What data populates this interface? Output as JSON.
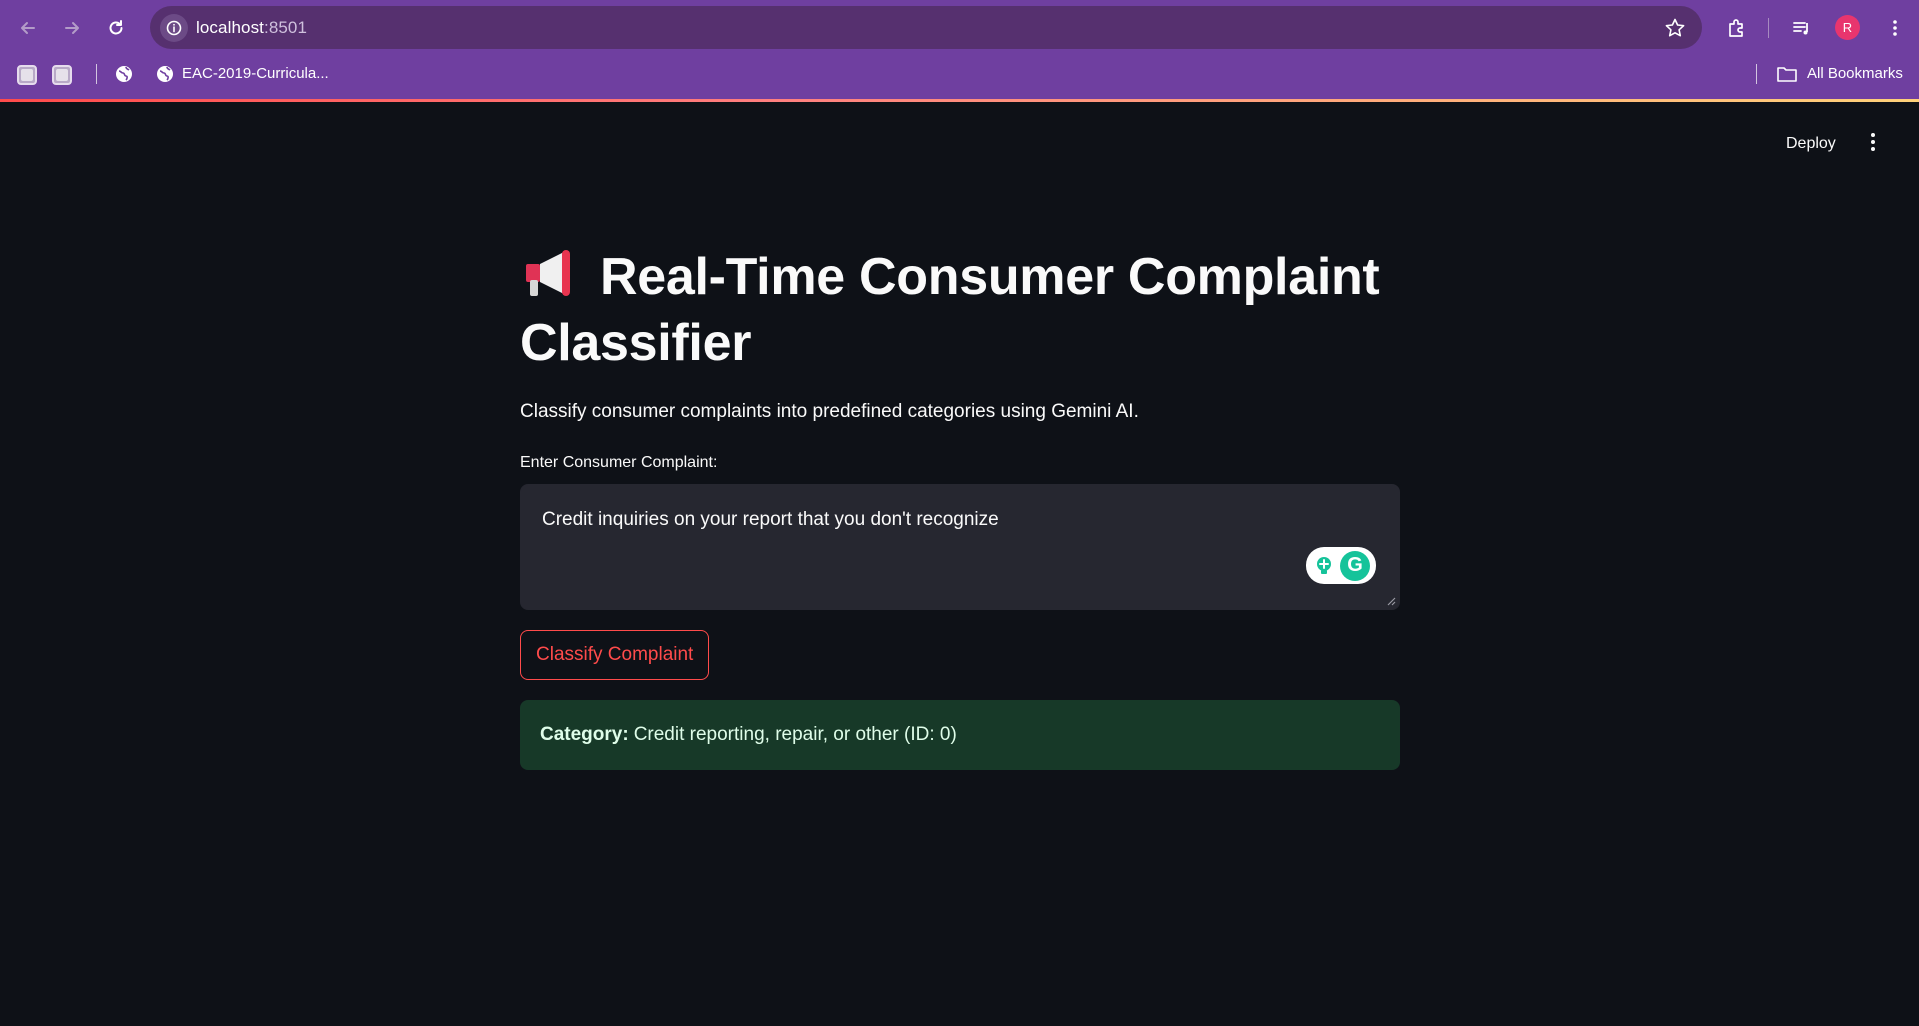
{
  "browser": {
    "url_host": "localhost",
    "url_port": ":8501",
    "profile_initial": "R",
    "bookmarks": [
      {
        "label": "EAC-2019-Curricula..."
      }
    ],
    "all_bookmarks_label": "All Bookmarks"
  },
  "app": {
    "deploy_label": "Deploy",
    "title": "Real-Time Consumer Complaint Classifier",
    "subtitle": "Classify consumer complaints into predefined categories using Gemini AI.",
    "input_label": "Enter Consumer Complaint:",
    "input_value": "Credit inquiries on your report that you don't recognize",
    "button_label": "Classify Complaint",
    "result_label": "Category:",
    "result_value": "Credit reporting, repair, or other (ID: 0)"
  },
  "colors": {
    "chrome": "#6f3fa0",
    "background": "#0e1117",
    "accent": "#ff4b4b",
    "success_bg": "#173928"
  }
}
